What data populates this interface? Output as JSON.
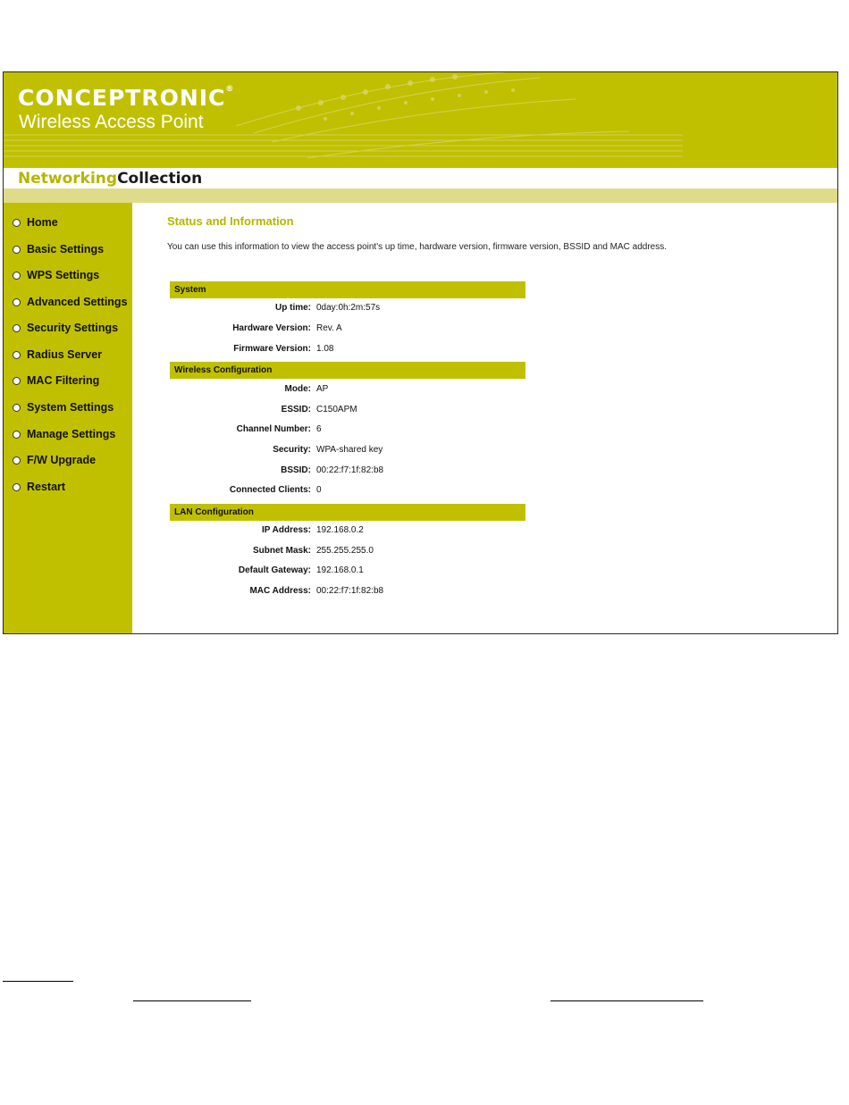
{
  "header": {
    "brand": "CONCEPTRONIC",
    "product": "Wireless Access Point",
    "collection_part1": "Networking",
    "collection_part2": "Collection"
  },
  "colors": {
    "accent": "#c0c000",
    "strip": "#dedc8a",
    "title": "#b5b500"
  },
  "sidebar": {
    "items": [
      {
        "label": "Home"
      },
      {
        "label": "Basic Settings"
      },
      {
        "label": "WPS Settings"
      },
      {
        "label": "Advanced Settings"
      },
      {
        "label": "Security Settings"
      },
      {
        "label": "Radius Server"
      },
      {
        "label": "MAC Filtering"
      },
      {
        "label": "System Settings"
      },
      {
        "label": "Manage Settings"
      },
      {
        "label": "F/W Upgrade"
      },
      {
        "label": "Restart"
      }
    ]
  },
  "main": {
    "title": "Status and Information",
    "intro": "You can use this information to view the access point's up time, hardware version, firmware version, BSSID and MAC address.",
    "system": {
      "heading": "System",
      "rows": [
        {
          "k": "Up time:",
          "v": "0day:0h:2m:57s"
        },
        {
          "k": "Hardware Version:",
          "v": "Rev. A"
        },
        {
          "k": "Firmware Version:",
          "v": "1.08"
        }
      ]
    },
    "wireless": {
      "heading": "Wireless Configuration",
      "rows": [
        {
          "k": "Mode:",
          "v": "AP"
        },
        {
          "k": "ESSID:",
          "v": "C150APM"
        },
        {
          "k": "Channel Number:",
          "v": "6"
        },
        {
          "k": "Security:",
          "v": "WPA-shared key"
        },
        {
          "k": "BSSID:",
          "v": "00:22:f7:1f:82:b8"
        },
        {
          "k": "Connected Clients:",
          "v": "0"
        }
      ]
    },
    "lan": {
      "heading": "LAN Configuration",
      "rows": [
        {
          "k": "IP Address:",
          "v": "192.168.0.2"
        },
        {
          "k": "Subnet Mask:",
          "v": "255.255.255.0"
        },
        {
          "k": "Default Gateway:",
          "v": "192.168.0.1"
        },
        {
          "k": "MAC Address:",
          "v": "00:22:f7:1f:82:b8"
        }
      ]
    }
  }
}
